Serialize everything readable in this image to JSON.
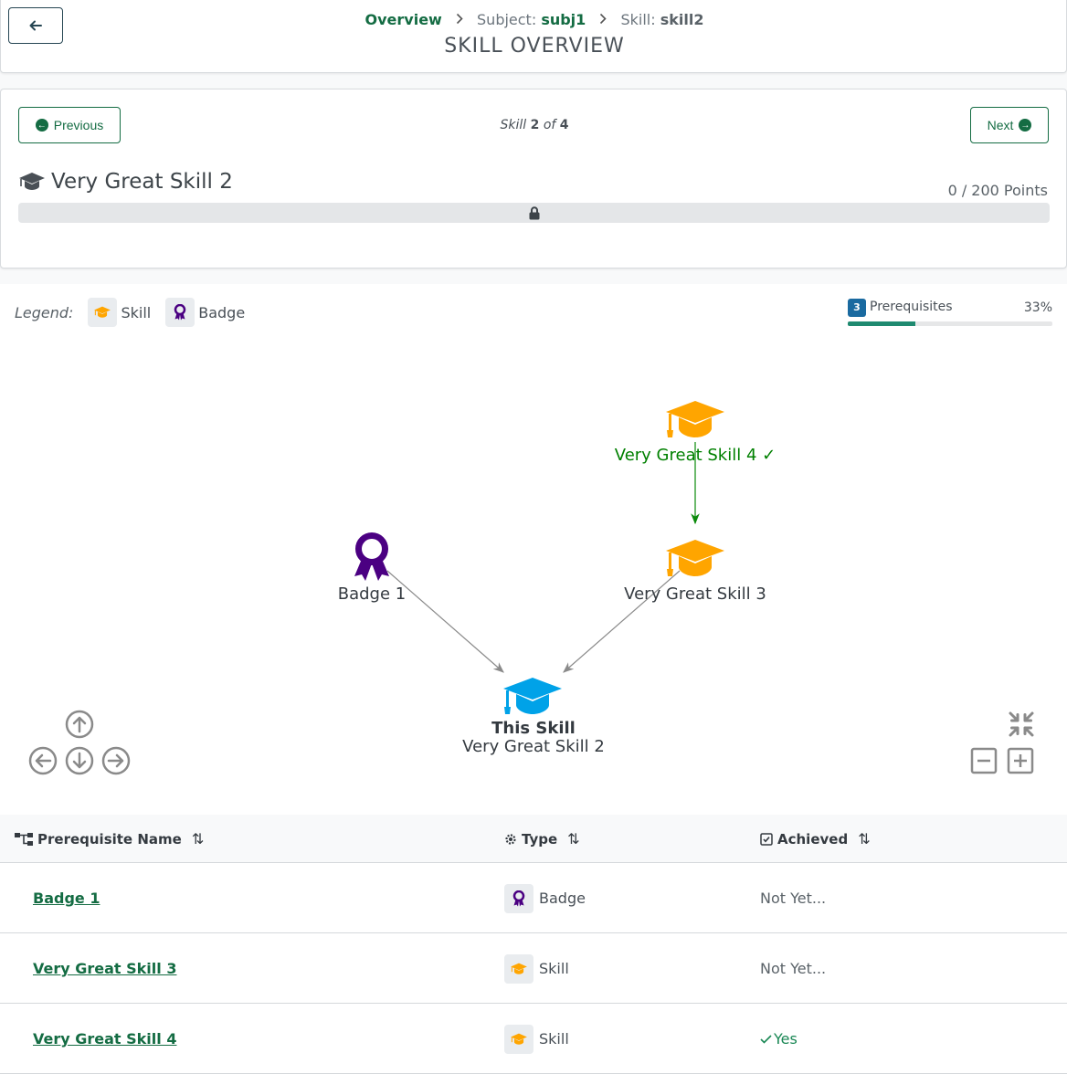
{
  "header": {
    "breadcrumb": {
      "overview": "Overview",
      "subject_label": "Subject:",
      "subject_value": "subj1",
      "skill_label": "Skill:",
      "skill_value": "skill2"
    },
    "title": "SKILL OVERVIEW"
  },
  "skill": {
    "prev_label": "Previous",
    "next_label": "Next",
    "position_prefix": "Skill",
    "position_current": "2",
    "position_of": "of",
    "position_total": "4",
    "name": "Very Great Skill 2",
    "points": "0 / 200 Points",
    "progress_fraction": 0
  },
  "legend": {
    "label": "Legend:",
    "items": [
      {
        "label": "Skill",
        "icon": "graduation-cap-icon"
      },
      {
        "label": "Badge",
        "icon": "award-icon"
      }
    ]
  },
  "prerequisites": {
    "count": "3",
    "label": "Prerequisites",
    "percent": "33%",
    "fraction": 0.33
  },
  "graph": {
    "nodes": {
      "badge1": {
        "label": "Badge 1",
        "color": "#4b0082"
      },
      "skill3": {
        "label": "Very Great Skill 3",
        "color": "#ffa500"
      },
      "skill4": {
        "label": "Very Great Skill 4 ✓",
        "color": "#ffa500",
        "label_color": "#008000"
      },
      "this": {
        "title": "This Skill",
        "label": "Very Great Skill 2",
        "color": "#00a2e8"
      }
    }
  },
  "table": {
    "headers": {
      "name": "Prerequisite Name",
      "type": "Type",
      "achieved": "Achieved"
    },
    "rows": [
      {
        "name": "Badge 1",
        "type": "Badge",
        "achieved": "Not Yet..."
      },
      {
        "name": "Very Great Skill 3",
        "type": "Skill",
        "achieved": "Not Yet..."
      },
      {
        "name": "Very Great Skill 4",
        "type": "Skill",
        "achieved": "Yes"
      }
    ]
  },
  "colors": {
    "primary": "#146c43",
    "skill_icon": "#ffa500",
    "badge_icon": "#4b0082",
    "this_skill": "#00a2e8",
    "achieved": "#008000"
  }
}
